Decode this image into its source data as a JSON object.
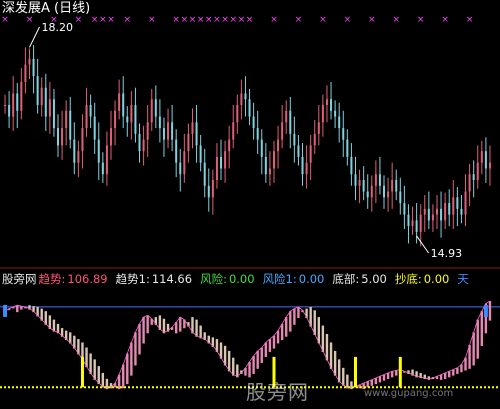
{
  "title": "深发展A (日线)",
  "colors": {
    "up": "#e0607a",
    "down": "#7fd4e0",
    "markers": "#ff44ff",
    "trend": "#e48ab2",
    "trend_down": "#d8c6b0",
    "risk_line": "#4a6cff",
    "bottom_line": "#ffff00",
    "buy_bar": "#ffff00",
    "top_mark": "#3a8cff"
  },
  "legend": [
    {
      "text": "股旁网",
      "color": "#e8e8e8"
    },
    {
      "text": "趋势:",
      "color": "#ff5577"
    },
    {
      "text": "106.89",
      "color": "#ff5577"
    },
    {
      "text": "趋势1:",
      "color": "#e8e8e8"
    },
    {
      "text": "114.66",
      "color": "#e8e8e8"
    },
    {
      "text": "风险:",
      "color": "#44dd44"
    },
    {
      "text": "0.00",
      "color": "#44dd44"
    },
    {
      "text": "风险1:",
      "color": "#44aaff"
    },
    {
      "text": "0.00",
      "color": "#44aaff"
    },
    {
      "text": "底部:",
      "color": "#e8e8e8"
    },
    {
      "text": "5.00",
      "color": "#e8e8e8"
    },
    {
      "text": "抄底:",
      "color": "#ffff00"
    },
    {
      "text": "0.00",
      "color": "#ffff00"
    },
    {
      "text": "天",
      "color": "#4488ff"
    }
  ],
  "watermark": "股旁网",
  "watermark_url": "www.gupang.com",
  "chart_data": [
    {
      "type": "candlestick",
      "annotations": [
        {
          "text": "18.20",
          "value": 18.2
        },
        {
          "text": "14.93",
          "value": 14.93
        }
      ],
      "ylim": [
        14.6,
        18.5
      ],
      "closes": [
        17.2,
        17.0,
        17.4,
        17.1,
        17.6,
        17.9,
        18.0,
        17.7,
        17.2,
        17.5,
        17.0,
        17.3,
        16.8,
        16.5,
        16.8,
        17.1,
        16.6,
        16.2,
        16.4,
        16.8,
        17.2,
        17.0,
        16.6,
        16.2,
        16.0,
        16.5,
        16.8,
        17.1,
        17.4,
        17.0,
        16.9,
        17.2,
        16.7,
        16.4,
        16.6,
        16.9,
        17.3,
        17.0,
        16.8,
        16.6,
        16.9,
        16.6,
        16.2,
        16.0,
        16.4,
        16.7,
        16.9,
        16.5,
        16.2,
        15.8,
        15.6,
        15.9,
        16.3,
        16.1,
        16.4,
        16.6,
        16.9,
        17.2,
        17.4,
        17.3,
        17.0,
        16.8,
        16.6,
        16.3,
        16.0,
        16.1,
        16.4,
        16.6,
        16.9,
        17.1,
        16.7,
        16.5,
        16.3,
        16.0,
        16.2,
        16.5,
        16.7,
        16.9,
        17.2,
        17.3,
        17.1,
        17.0,
        16.8,
        16.6,
        16.3,
        16.0,
        15.8,
        15.9,
        15.7,
        15.6,
        15.8,
        16.0,
        15.8,
        15.6,
        15.7,
        15.9,
        15.7,
        15.5,
        15.3,
        15.1,
        15.2,
        15.0,
        15.3,
        15.4,
        15.2,
        15.3,
        15.4,
        15.2,
        15.5,
        15.3,
        15.6,
        15.4,
        15.3,
        15.7,
        16.0,
        15.9,
        16.2,
        16.4,
        16.1,
        16.2
      ]
    },
    {
      "type": "indicator",
      "series": [
        {
          "name": "趋势",
          "current": 106.89
        },
        {
          "name": "趋势1",
          "current": 114.66
        },
        {
          "name": "风险",
          "current": 0.0
        },
        {
          "name": "风险1",
          "current": 0.0
        },
        {
          "name": "底部",
          "current": 5.0
        },
        {
          "name": "抄底",
          "current": 0.0
        }
      ],
      "ylim": [
        -10,
        120
      ],
      "trend": [
        95,
        98,
        100,
        102,
        101,
        100,
        98,
        95,
        90,
        85,
        80,
        75,
        72,
        70,
        66,
        62,
        58,
        52,
        45,
        38,
        30,
        22,
        15,
        10,
        6,
        4,
        5,
        10,
        20,
        32,
        45,
        58,
        70,
        80,
        88,
        90,
        86,
        80,
        74,
        70,
        72,
        76,
        82,
        88,
        85,
        78,
        70,
        66,
        64,
        62,
        58,
        54,
        48,
        40,
        32,
        25,
        20,
        18,
        22,
        28,
        35,
        42,
        48,
        52,
        58,
        62,
        66,
        72,
        80,
        88,
        95,
        98,
        100,
        96,
        88,
        78,
        68,
        58,
        48,
        38,
        28,
        20,
        12,
        8,
        5,
        4,
        6,
        8,
        10,
        12,
        14,
        16,
        18,
        20,
        22,
        24,
        25,
        26,
        24,
        22,
        20,
        18,
        17,
        16,
        15,
        16,
        18,
        20,
        22,
        24,
        26,
        28,
        32,
        40,
        55,
        70,
        85,
        95,
        104,
        107
      ],
      "buy_signals": [
        19,
        66,
        86,
        97
      ],
      "bottom_level": 5,
      "risk_level": 100
    }
  ]
}
